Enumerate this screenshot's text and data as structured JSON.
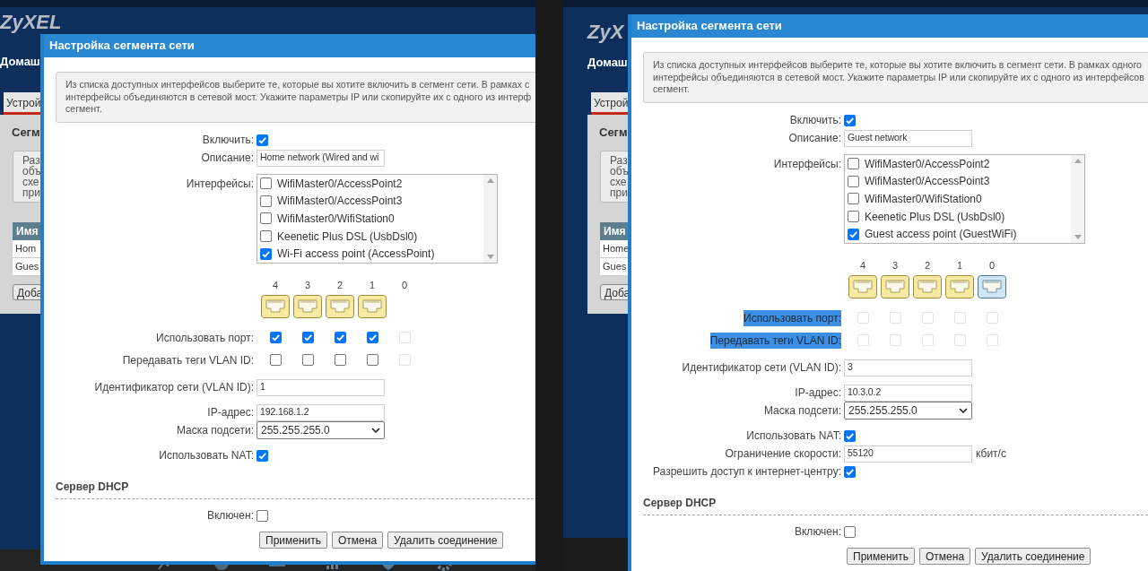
{
  "screens": [
    {
      "page": {
        "logo": "ZyXEL",
        "nav": "Домаш",
        "tab": "Устрой",
        "heading": "Сегм",
        "note_lines": [
          "Раз",
          "объ",
          "схе",
          "при"
        ],
        "table_header": "Имя",
        "table_rows": [
          "Hom",
          "Gues"
        ],
        "add_button": "Доба"
      },
      "dialog": {
        "title": "Настройка сегмента сети",
        "intro_lines": [
          "Из списка доступных интерфейсов выберите те, которые вы хотите включить в сегмент сети. В рамках с",
          "интерфейсы объединяются в сетевой мост. Укажите параметры IP или скопируйте их с одного из интерф",
          "сегмент."
        ],
        "groups": [
          [
            {
              "kind": "checkbox",
              "label": "Включить:",
              "checked": true
            },
            {
              "kind": "text",
              "label": "Описание:",
              "value": "Home network (Wired and wi"
            },
            {
              "kind": "listbox",
              "label": "Интерфейсы:",
              "items": [
                {
                  "label": "WifiMaster0/AccessPoint2",
                  "checked": false
                },
                {
                  "label": "WifiMaster0/AccessPoint3",
                  "checked": false
                },
                {
                  "label": "WifiMaster0/WifiStation0",
                  "checked": false
                },
                {
                  "label": "Keenetic Plus DSL (UsbDsl0)",
                  "checked": false
                },
                {
                  "label": "Wi-Fi access point (AccessPoint)",
                  "checked": true
                }
              ]
            }
          ],
          [
            {
              "kind": "ports",
              "use_port_label": {
                "text": "Использовать порт:",
                "highlighted": false
              },
              "vlan_tags_label": {
                "text": "Передавать теги VLAN ID:",
                "highlighted": false
              },
              "ports": [
                {
                  "number": "4",
                  "kind": "lan",
                  "use_port": {
                    "checked": true,
                    "disabled": false
                  },
                  "vlan_tags": {
                    "checked": false,
                    "disabled": false
                  }
                },
                {
                  "number": "3",
                  "kind": "lan",
                  "use_port": {
                    "checked": true,
                    "disabled": false
                  },
                  "vlan_tags": {
                    "checked": false,
                    "disabled": false
                  }
                },
                {
                  "number": "2",
                  "kind": "lan",
                  "use_port": {
                    "checked": true,
                    "disabled": false
                  },
                  "vlan_tags": {
                    "checked": false,
                    "disabled": false
                  }
                },
                {
                  "number": "1",
                  "kind": "lan",
                  "use_port": {
                    "checked": true,
                    "disabled": false
                  },
                  "vlan_tags": {
                    "checked": false,
                    "disabled": false
                  }
                },
                {
                  "number": "0",
                  "kind": "none",
                  "use_port": {
                    "checked": false,
                    "disabled": true
                  },
                  "vlan_tags": {
                    "checked": false,
                    "disabled": true
                  }
                }
              ]
            }
          ],
          [
            {
              "kind": "text",
              "label": "Идентификатор сети (VLAN ID):",
              "value": "1"
            }
          ],
          [
            {
              "kind": "text",
              "label": "IP-адрес:",
              "value": "192.168.1.2"
            },
            {
              "kind": "select",
              "label": "Маска подсети:",
              "value": "255.255.255.0"
            }
          ],
          [
            {
              "kind": "checkbox",
              "label": "Использовать NAT:",
              "checked": true
            }
          ]
        ],
        "dhcp": {
          "title": "Сервер DHCP",
          "rows": [
            {
              "kind": "checkbox",
              "label": "Включен:",
              "checked": false
            }
          ]
        },
        "buttons": [
          "Применить",
          "Отмена",
          "Удалить соединение"
        ]
      }
    },
    {
      "page": {
        "logo": "ZyX",
        "nav": "Домаш",
        "tab": "Устрой",
        "heading": "Сегм",
        "note_lines": [
          "Раз",
          "объ",
          "схе",
          "при"
        ],
        "table_header": "Имя",
        "table_rows": [
          "Home",
          "Gues"
        ],
        "add_button": "Доба"
      },
      "dialog": {
        "title": "Настройка сегмента сети",
        "intro_lines": [
          "Из списка доступных интерфейсов выберите те, которые вы хотите включить в сегмент сети. В рамках одного",
          "интерфейсы объединяются в сетевой мост. Укажите параметры IP или скопируйте их с одного из интерфейсов",
          "сегмент."
        ],
        "groups": [
          [
            {
              "kind": "checkbox",
              "label": "Включить:",
              "checked": true
            },
            {
              "kind": "text",
              "label": "Описание:",
              "value": "Guest network"
            },
            {
              "kind": "listbox",
              "label": "Интерфейсы:",
              "items": [
                {
                  "label": "WifiMaster0/AccessPoint2",
                  "checked": false
                },
                {
                  "label": "WifiMaster0/AccessPoint3",
                  "checked": false
                },
                {
                  "label": "WifiMaster0/WifiStation0",
                  "checked": false
                },
                {
                  "label": "Keenetic Plus DSL (UsbDsl0)",
                  "checked": false
                },
                {
                  "label": "Guest access point (GuestWiFi)",
                  "checked": true
                }
              ]
            }
          ],
          [
            {
              "kind": "ports",
              "use_port_label": {
                "text": "Использовать порт:",
                "highlighted": true
              },
              "vlan_tags_label": {
                "text": "Передавать теги VLAN ID:",
                "highlighted": true
              },
              "ports": [
                {
                  "number": "4",
                  "kind": "lan",
                  "use_port": {
                    "checked": false,
                    "disabled": true
                  },
                  "vlan_tags": {
                    "checked": false,
                    "disabled": true
                  }
                },
                {
                  "number": "3",
                  "kind": "lan",
                  "use_port": {
                    "checked": false,
                    "disabled": true
                  },
                  "vlan_tags": {
                    "checked": false,
                    "disabled": true
                  }
                },
                {
                  "number": "2",
                  "kind": "lan",
                  "use_port": {
                    "checked": false,
                    "disabled": true
                  },
                  "vlan_tags": {
                    "checked": false,
                    "disabled": true
                  }
                },
                {
                  "number": "1",
                  "kind": "lan",
                  "use_port": {
                    "checked": false,
                    "disabled": true
                  },
                  "vlan_tags": {
                    "checked": false,
                    "disabled": true
                  }
                },
                {
                  "number": "0",
                  "kind": "wan",
                  "use_port": {
                    "checked": false,
                    "disabled": true
                  },
                  "vlan_tags": {
                    "checked": false,
                    "disabled": true
                  }
                }
              ]
            }
          ],
          [
            {
              "kind": "text",
              "label": "Идентификатор сети (VLAN ID):",
              "value": "3"
            }
          ],
          [
            {
              "kind": "text",
              "label": "IP-адрес:",
              "value": "10.3.0.2"
            },
            {
              "kind": "select",
              "label": "Маска подсети:",
              "value": "255.255.255.0"
            }
          ],
          [
            {
              "kind": "checkbox",
              "label": "Использовать NAT:",
              "checked": true
            },
            {
              "kind": "text",
              "label": "Ограничение скорости:",
              "value": "55120",
              "suffix": "кбит/с"
            },
            {
              "kind": "checkbox",
              "label": "Разрешить доступ к интернет-центру:",
              "checked": true
            }
          ]
        ],
        "dhcp": {
          "title": "Сервер DHCP",
          "rows": [
            {
              "kind": "checkbox",
              "label": "Включен:",
              "checked": false
            }
          ]
        },
        "buttons": [
          "Применить",
          "Отмена",
          "Удалить соединение"
        ]
      }
    }
  ]
}
